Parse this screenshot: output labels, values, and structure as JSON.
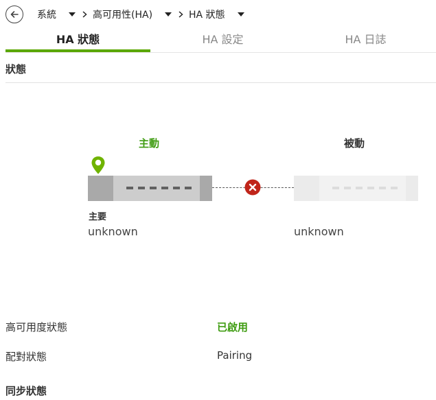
{
  "breadcrumb": {
    "items": [
      {
        "label": "系統"
      },
      {
        "label": "高可用性(HA)"
      },
      {
        "label": "HA 狀態"
      }
    ]
  },
  "tabs": [
    {
      "label": "HA 狀態",
      "active": true
    },
    {
      "label": "HA 設定",
      "active": false
    },
    {
      "label": "HA 日誌",
      "active": false
    }
  ],
  "status_section": {
    "title": "狀態"
  },
  "topology": {
    "active_role_label": "主動",
    "passive_role_label": "被動",
    "primary_label": "主要",
    "primary_status": "unknown",
    "secondary_status": "unknown",
    "link_state": "disconnected"
  },
  "details": {
    "ha_status_label": "高可用度狀態",
    "ha_status_value": "已啟用",
    "pairing_label": "配對狀態",
    "pairing_value": "Pairing"
  },
  "sync_section": {
    "title": "同步狀態"
  },
  "colors": {
    "accent_green": "#5aa700",
    "status_green": "#3f9c11",
    "error_red": "#c0251a",
    "pin_green": "#6fb300"
  }
}
